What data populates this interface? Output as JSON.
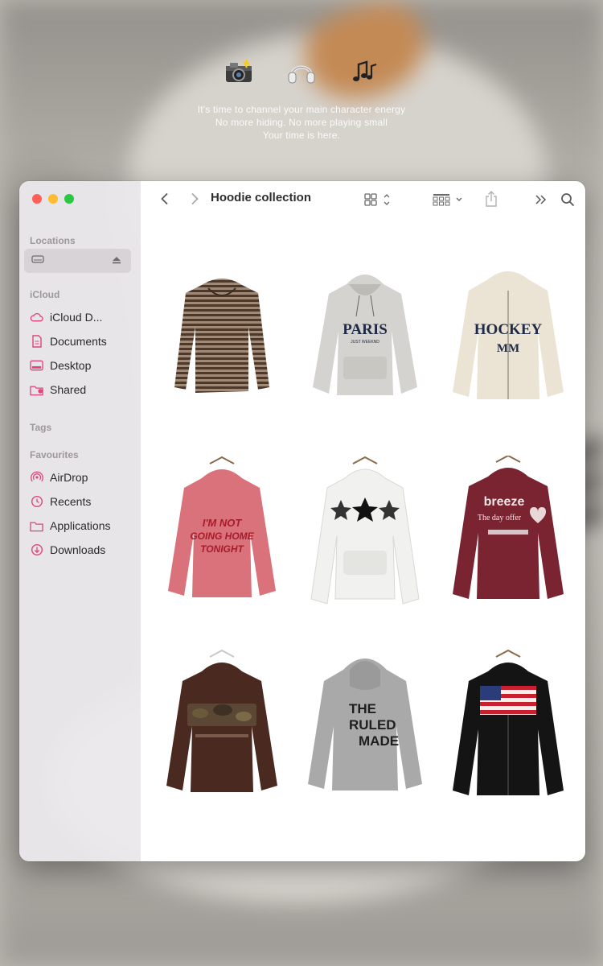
{
  "caption": {
    "emojis": [
      "camera-with-flash",
      "headphones",
      "music-notes"
    ],
    "lines": [
      "It's time to channel your main character energy",
      "No more hiding. No more playing small",
      "Your time is here."
    ]
  },
  "sidebar": {
    "locations_title": "Locations",
    "icloud_title": "iCloud",
    "icloud_items": [
      {
        "label": "iCloud D...",
        "icon": "cloud-icon"
      },
      {
        "label": "Documents",
        "icon": "document-icon"
      },
      {
        "label": "Desktop",
        "icon": "desktop-icon"
      },
      {
        "label": "Shared",
        "icon": "shared-folder-icon"
      }
    ],
    "tags_title": "Tags",
    "favourites_title": "Favourites",
    "favourite_items": [
      {
        "label": "AirDrop",
        "icon": "airdrop-icon"
      },
      {
        "label": "Recents",
        "icon": "clock-icon"
      },
      {
        "label": "Applications",
        "icon": "applications-folder-icon"
      },
      {
        "label": "Downloads",
        "icon": "download-icon"
      }
    ]
  },
  "toolbar": {
    "title": "Hoodie collection"
  },
  "items": [
    {
      "kind": "striped hooded top",
      "color": "#5c4535"
    },
    {
      "kind": "hoodie",
      "color": "#d4d3cf",
      "text": "PARIS",
      "sub": "JUST WEEKND",
      "textColor": "#1f2a44"
    },
    {
      "kind": "zip hoodie",
      "color": "#ebe3d3",
      "text": "HOCKEY",
      "sub": "MM",
      "textColor": "#1f2a44"
    },
    {
      "kind": "hoodie",
      "color": "#d9727b",
      "text": "I'M NOT",
      "sub": "GOING HOME TONIGHT",
      "textColor": "#a81c2a"
    },
    {
      "kind": "hoodie",
      "color": "#f1f1ef",
      "text": "stars",
      "textColor": "#222222"
    },
    {
      "kind": "hoodie",
      "color": "#7a2431",
      "text": "breeze",
      "sub": "The day offer",
      "textColor": "#f2e6e6"
    },
    {
      "kind": "hoodie",
      "color": "#4a2a20",
      "text": "",
      "textColor": "#6b5a3a"
    },
    {
      "kind": "zip hoodie back",
      "color": "#a9a9a9",
      "text": "THE RULED",
      "sub": "MADE",
      "textColor": "#1e1e1e"
    },
    {
      "kind": "zip hoodie",
      "color": "#141414",
      "text": "flag",
      "textColor": "#c8202e"
    }
  ]
}
